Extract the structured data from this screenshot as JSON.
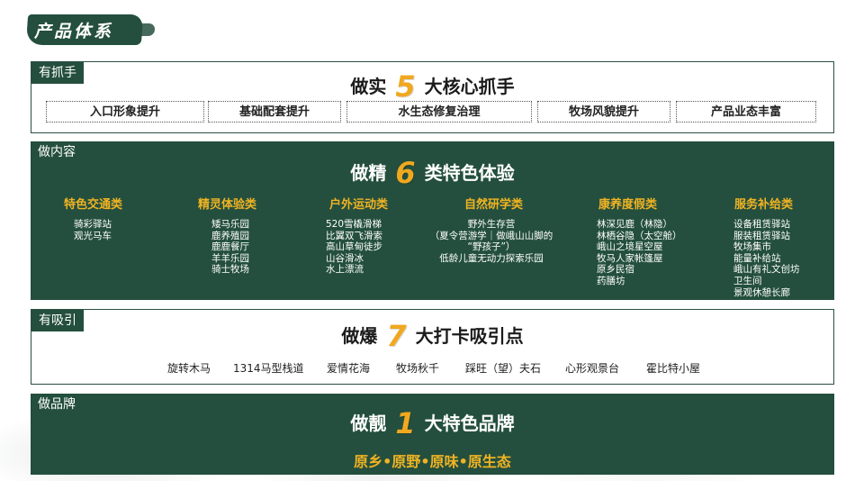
{
  "header": {
    "title": "产品体系"
  },
  "section1": {
    "tag": "有抓手",
    "heading_pre": "做实",
    "heading_num": "5",
    "heading_post": "大核心抓手",
    "pills": [
      "入口形象提升",
      "基础配套提升",
      "水生态修复治理",
      "牧场风貌提升",
      "产品业态丰富"
    ]
  },
  "section2": {
    "tag": "做内容",
    "heading_pre": "做精",
    "heading_num": "6",
    "heading_post": "类特色体验",
    "columns": [
      {
        "title": "特色交通类",
        "items": [
          "骑彩驿站",
          "观光马车"
        ]
      },
      {
        "title": "精灵体验类",
        "items": [
          "矮马乐园",
          "鹿养殖园",
          "鹿鹿餐厅",
          "羊羊乐园",
          "骑士牧场"
        ]
      },
      {
        "title": "户外运动类",
        "items": [
          "520雪橇滑梯",
          "比翼双飞滑索",
          "高山草甸徒步",
          "山谷滑冰",
          "水上漂流"
        ]
      },
      {
        "title": "自然研学类",
        "items": [
          "野外生存营",
          "（夏令营游学｜做峨山山脚的",
          "“野孩子”）",
          "低龄儿童无动力探索乐园"
        ]
      },
      {
        "title": "康养度假类",
        "items": [
          "林深见鹿（林隐）",
          "林栖谷隐（太空舱）",
          "峨山之境星空屋",
          "牧马人家帐篷屋",
          "原乡民宿",
          "药膳坊"
        ]
      },
      {
        "title": "服务补给类",
        "items": [
          "设备租赁驿站",
          "服装租赁驿站",
          "牧场集市",
          "能量补给站",
          "峨山有礼文创坊",
          "卫生间",
          "景观休憩长廊"
        ]
      }
    ]
  },
  "section3": {
    "tag": "有吸引",
    "heading_pre": "做爆",
    "heading_num": "7",
    "heading_post": "大打卡吸引点",
    "items": [
      "旋转木马",
      "1314马型栈道",
      "爱情花海",
      "牧场秋千",
      "踩旺（望）夫石",
      "心形观景台",
      "霍比特小屋"
    ]
  },
  "section4": {
    "tag": "做品牌",
    "heading_pre": "做靓",
    "heading_num": "1",
    "heading_post": "大特色品牌",
    "brand_line": "原乡•原野•原味•原生态"
  },
  "colors": {
    "primary_green": "#244f3e",
    "accent_gold": "#f0b323"
  }
}
